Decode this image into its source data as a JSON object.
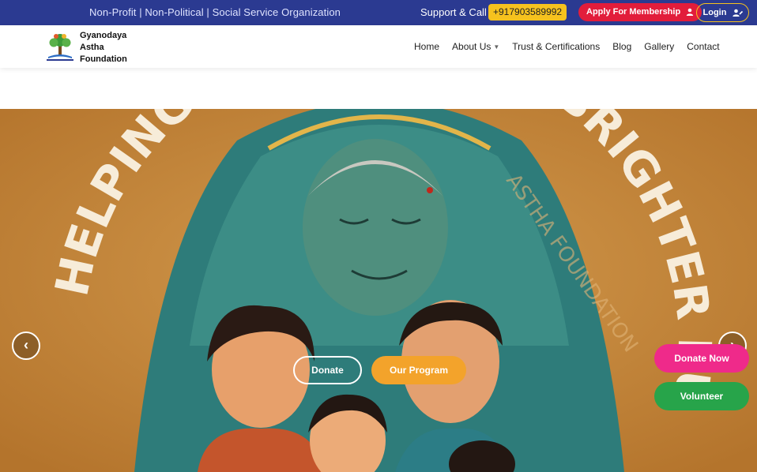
{
  "topbar": {
    "tagline": "Non-Profit | Non-Political | Social Service Organization",
    "support_label": "Support & Call",
    "phone": "+917903589992",
    "apply_label": "Apply For Membership",
    "login_label": "Login"
  },
  "brand": {
    "name_line1": "Gyanodaya",
    "name_line2": "Astha",
    "name_line3": "Foundation",
    "logo_icon": "tree-logo-icon"
  },
  "nav": {
    "items": [
      "Home",
      "About Us",
      "Trust & Certifications",
      "Blog",
      "Gallery",
      "Contact"
    ]
  },
  "hero": {
    "arc_left": "HELPING",
    "arc_right": "BRIGHTER FUTURE",
    "watermark": "ASTHA FOUNDATION",
    "donate_label": "Donate",
    "program_label": "Our Program",
    "prev_icon": "chevron-left-icon",
    "next_icon": "chevron-right-icon"
  },
  "floating": {
    "donate_now_label": "Donate Now",
    "volunteer_label": "Volunteer"
  },
  "colors": {
    "topbar_bg": "#2b3a91",
    "phone_bg": "#f6c21e",
    "apply_bg": "#e21d3b",
    "program_bg": "#f3a32b",
    "donate_now_bg": "#ef2a8a",
    "volunteer_bg": "#27a44a"
  }
}
